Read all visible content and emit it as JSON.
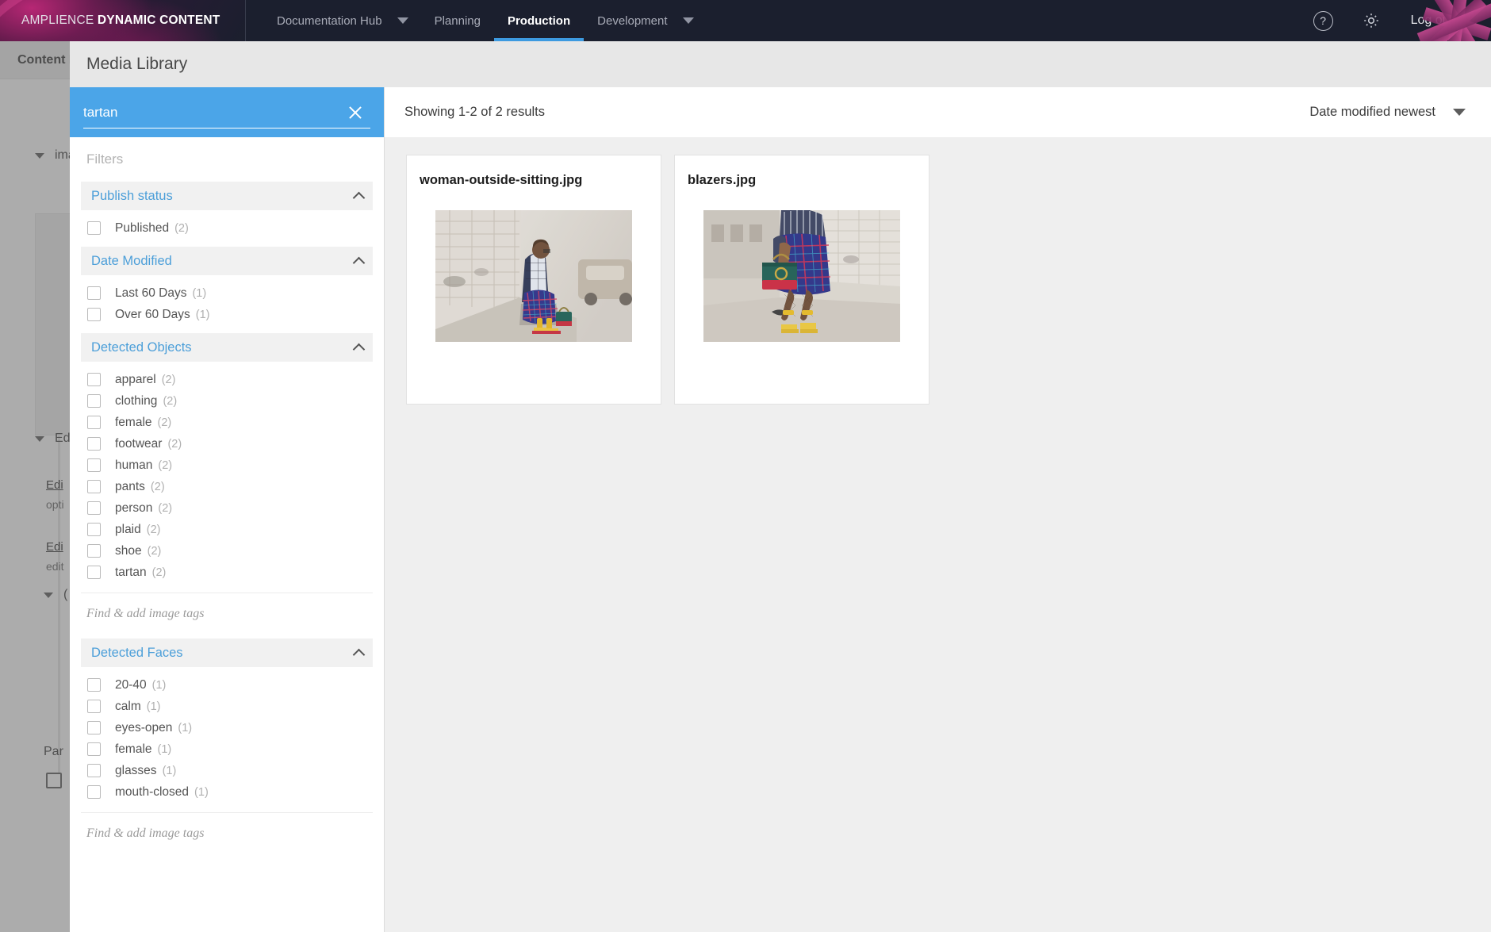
{
  "topnav": {
    "brand_light": "AMPLIENCE",
    "brand_bold": "DYNAMIC CONTENT",
    "items": [
      {
        "label": "Documentation Hub",
        "active": false,
        "caret": true
      },
      {
        "label": "Planning",
        "active": false,
        "caret": false
      },
      {
        "label": "Production",
        "active": true,
        "caret": false
      },
      {
        "label": "Development",
        "active": false,
        "caret": true
      }
    ],
    "help_glyph": "?",
    "logout_label": "Log out",
    "accent_color": "#3d9ae0",
    "background_color": "#1b1f2e"
  },
  "background_page": {
    "subheader_title": "Content I",
    "rows": [
      {
        "label": "ima"
      },
      {
        "label": "Edi"
      },
      {
        "label": "("
      }
    ],
    "links": [
      {
        "label": "Edi",
        "sub": "opti"
      },
      {
        "label": "Edi",
        "sub": "edit"
      }
    ],
    "partial_label": "Par"
  },
  "modal": {
    "title": "Media Library",
    "search": {
      "value": "tartan",
      "placeholder": "",
      "clear_icon": "close-icon",
      "band_color": "#4ba5e8"
    },
    "filters_label": "Filters",
    "sections": [
      {
        "title": "Publish status",
        "expanded": true,
        "options": [
          {
            "label": "Published",
            "count": "(2)",
            "checked": false
          }
        ]
      },
      {
        "title": "Date Modified",
        "expanded": true,
        "options": [
          {
            "label": "Last 60 Days",
            "count": "(1)",
            "checked": false
          },
          {
            "label": "Over 60 Days",
            "count": "(1)",
            "checked": false
          }
        ]
      },
      {
        "title": "Detected Objects",
        "expanded": true,
        "options": [
          {
            "label": "apparel",
            "count": "(2)",
            "checked": false
          },
          {
            "label": "clothing",
            "count": "(2)",
            "checked": false
          },
          {
            "label": "female",
            "count": "(2)",
            "checked": false
          },
          {
            "label": "footwear",
            "count": "(2)",
            "checked": false
          },
          {
            "label": "human",
            "count": "(2)",
            "checked": false
          },
          {
            "label": "pants",
            "count": "(2)",
            "checked": false
          },
          {
            "label": "person",
            "count": "(2)",
            "checked": false
          },
          {
            "label": "plaid",
            "count": "(2)",
            "checked": false
          },
          {
            "label": "shoe",
            "count": "(2)",
            "checked": false
          },
          {
            "label": "tartan",
            "count": "(2)",
            "checked": false
          }
        ],
        "tag_placeholder": "Find & add image tags"
      },
      {
        "title": "Detected Faces",
        "expanded": true,
        "options": [
          {
            "label": "20-40",
            "count": "(1)",
            "checked": false
          },
          {
            "label": "calm",
            "count": "(1)",
            "checked": false
          },
          {
            "label": "eyes-open",
            "count": "(1)",
            "checked": false
          },
          {
            "label": "female",
            "count": "(1)",
            "checked": false
          },
          {
            "label": "glasses",
            "count": "(1)",
            "checked": false
          },
          {
            "label": "mouth-closed",
            "count": "(1)",
            "checked": false
          }
        ],
        "tag_placeholder": "Find & add image tags"
      }
    ],
    "results": {
      "count_text": "Showing 1-2 of 2 results",
      "sort_label": "Date modified newest",
      "items": [
        {
          "name": "woman-outside-sitting.jpg"
        },
        {
          "name": "blazers.jpg"
        }
      ]
    }
  }
}
